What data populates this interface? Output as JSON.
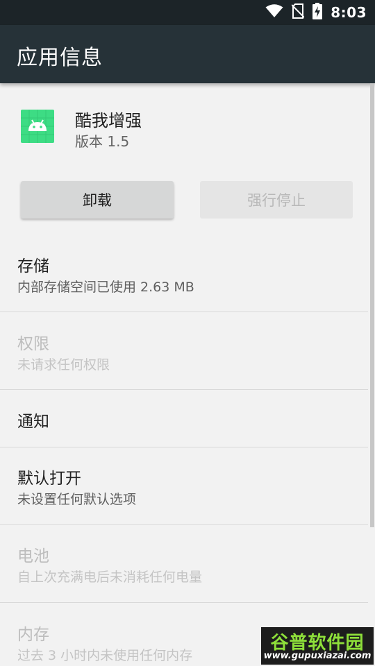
{
  "status_bar": {
    "time": "8:03",
    "icons": [
      "wifi-icon",
      "no-sim-icon",
      "battery-charging-icon"
    ]
  },
  "app_bar": {
    "title": "应用信息"
  },
  "app": {
    "icon": "android-icon",
    "name": "酷我增强",
    "version": "版本 1.5"
  },
  "buttons": {
    "uninstall": "卸载",
    "force_stop": "强行停止"
  },
  "settings": [
    {
      "title": "存储",
      "subtitle": "内部存储空间已使用 2.63 MB",
      "enabled": true
    },
    {
      "title": "权限",
      "subtitle": "未请求任何权限",
      "enabled": false
    },
    {
      "title": "通知",
      "subtitle": "",
      "enabled": true
    },
    {
      "title": "默认打开",
      "subtitle": "未设置任何默认选项",
      "enabled": true
    },
    {
      "title": "电池",
      "subtitle": "自上次充满电后未消耗任何电量",
      "enabled": false
    },
    {
      "title": "内存",
      "subtitle": "过去 3 小时内未使用任何内存",
      "enabled": false
    }
  ],
  "watermark": {
    "text": "谷普软件园",
    "url": "www.gupuxiazai.com"
  },
  "colors": {
    "status_bar": "#1c2428",
    "app_bar": "#263238",
    "android_green": "#3ddc84",
    "watermark_green": "#8ee03a"
  }
}
